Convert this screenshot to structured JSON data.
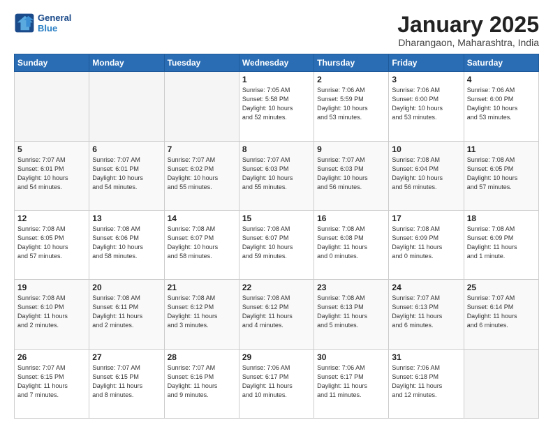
{
  "header": {
    "logo_line1": "General",
    "logo_line2": "Blue",
    "title": "January 2025",
    "subtitle": "Dharangaon, Maharashtra, India"
  },
  "days_of_week": [
    "Sunday",
    "Monday",
    "Tuesday",
    "Wednesday",
    "Thursday",
    "Friday",
    "Saturday"
  ],
  "weeks": [
    [
      {
        "day": "",
        "info": ""
      },
      {
        "day": "",
        "info": ""
      },
      {
        "day": "",
        "info": ""
      },
      {
        "day": "1",
        "info": "Sunrise: 7:05 AM\nSunset: 5:58 PM\nDaylight: 10 hours\nand 52 minutes."
      },
      {
        "day": "2",
        "info": "Sunrise: 7:06 AM\nSunset: 5:59 PM\nDaylight: 10 hours\nand 53 minutes."
      },
      {
        "day": "3",
        "info": "Sunrise: 7:06 AM\nSunset: 6:00 PM\nDaylight: 10 hours\nand 53 minutes."
      },
      {
        "day": "4",
        "info": "Sunrise: 7:06 AM\nSunset: 6:00 PM\nDaylight: 10 hours\nand 53 minutes."
      }
    ],
    [
      {
        "day": "5",
        "info": "Sunrise: 7:07 AM\nSunset: 6:01 PM\nDaylight: 10 hours\nand 54 minutes."
      },
      {
        "day": "6",
        "info": "Sunrise: 7:07 AM\nSunset: 6:01 PM\nDaylight: 10 hours\nand 54 minutes."
      },
      {
        "day": "7",
        "info": "Sunrise: 7:07 AM\nSunset: 6:02 PM\nDaylight: 10 hours\nand 55 minutes."
      },
      {
        "day": "8",
        "info": "Sunrise: 7:07 AM\nSunset: 6:03 PM\nDaylight: 10 hours\nand 55 minutes."
      },
      {
        "day": "9",
        "info": "Sunrise: 7:07 AM\nSunset: 6:03 PM\nDaylight: 10 hours\nand 56 minutes."
      },
      {
        "day": "10",
        "info": "Sunrise: 7:08 AM\nSunset: 6:04 PM\nDaylight: 10 hours\nand 56 minutes."
      },
      {
        "day": "11",
        "info": "Sunrise: 7:08 AM\nSunset: 6:05 PM\nDaylight: 10 hours\nand 57 minutes."
      }
    ],
    [
      {
        "day": "12",
        "info": "Sunrise: 7:08 AM\nSunset: 6:05 PM\nDaylight: 10 hours\nand 57 minutes."
      },
      {
        "day": "13",
        "info": "Sunrise: 7:08 AM\nSunset: 6:06 PM\nDaylight: 10 hours\nand 58 minutes."
      },
      {
        "day": "14",
        "info": "Sunrise: 7:08 AM\nSunset: 6:07 PM\nDaylight: 10 hours\nand 58 minutes."
      },
      {
        "day": "15",
        "info": "Sunrise: 7:08 AM\nSunset: 6:07 PM\nDaylight: 10 hours\nand 59 minutes."
      },
      {
        "day": "16",
        "info": "Sunrise: 7:08 AM\nSunset: 6:08 PM\nDaylight: 11 hours\nand 0 minutes."
      },
      {
        "day": "17",
        "info": "Sunrise: 7:08 AM\nSunset: 6:09 PM\nDaylight: 11 hours\nand 0 minutes."
      },
      {
        "day": "18",
        "info": "Sunrise: 7:08 AM\nSunset: 6:09 PM\nDaylight: 11 hours\nand 1 minute."
      }
    ],
    [
      {
        "day": "19",
        "info": "Sunrise: 7:08 AM\nSunset: 6:10 PM\nDaylight: 11 hours\nand 2 minutes."
      },
      {
        "day": "20",
        "info": "Sunrise: 7:08 AM\nSunset: 6:11 PM\nDaylight: 11 hours\nand 2 minutes."
      },
      {
        "day": "21",
        "info": "Sunrise: 7:08 AM\nSunset: 6:12 PM\nDaylight: 11 hours\nand 3 minutes."
      },
      {
        "day": "22",
        "info": "Sunrise: 7:08 AM\nSunset: 6:12 PM\nDaylight: 11 hours\nand 4 minutes."
      },
      {
        "day": "23",
        "info": "Sunrise: 7:08 AM\nSunset: 6:13 PM\nDaylight: 11 hours\nand 5 minutes."
      },
      {
        "day": "24",
        "info": "Sunrise: 7:07 AM\nSunset: 6:13 PM\nDaylight: 11 hours\nand 6 minutes."
      },
      {
        "day": "25",
        "info": "Sunrise: 7:07 AM\nSunset: 6:14 PM\nDaylight: 11 hours\nand 6 minutes."
      }
    ],
    [
      {
        "day": "26",
        "info": "Sunrise: 7:07 AM\nSunset: 6:15 PM\nDaylight: 11 hours\nand 7 minutes."
      },
      {
        "day": "27",
        "info": "Sunrise: 7:07 AM\nSunset: 6:15 PM\nDaylight: 11 hours\nand 8 minutes."
      },
      {
        "day": "28",
        "info": "Sunrise: 7:07 AM\nSunset: 6:16 PM\nDaylight: 11 hours\nand 9 minutes."
      },
      {
        "day": "29",
        "info": "Sunrise: 7:06 AM\nSunset: 6:17 PM\nDaylight: 11 hours\nand 10 minutes."
      },
      {
        "day": "30",
        "info": "Sunrise: 7:06 AM\nSunset: 6:17 PM\nDaylight: 11 hours\nand 11 minutes."
      },
      {
        "day": "31",
        "info": "Sunrise: 7:06 AM\nSunset: 6:18 PM\nDaylight: 11 hours\nand 12 minutes."
      },
      {
        "day": "",
        "info": ""
      }
    ]
  ]
}
